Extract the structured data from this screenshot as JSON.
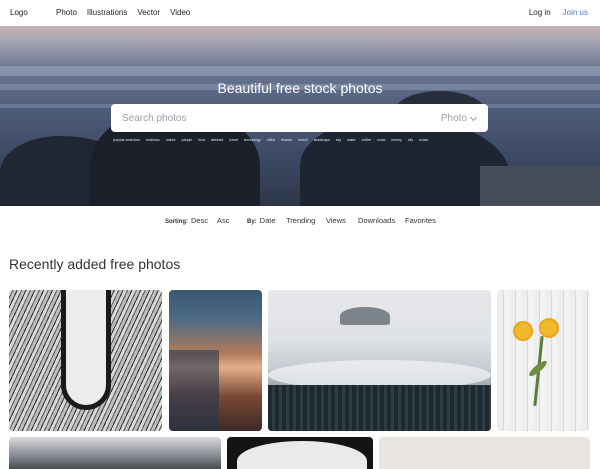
{
  "nav": {
    "logo": "Logo",
    "links": [
      "Photo",
      "Illustrations",
      "Vector",
      "Video"
    ],
    "login": "Log in",
    "join": "Join us"
  },
  "hero": {
    "headline": "Beautiful free stock photos",
    "search_placeholder": "Search photos",
    "search_type": "Photo",
    "tags": [
      "popular searches",
      "business",
      "nature",
      "people",
      "food",
      "abstract",
      "travel",
      "technology",
      "office",
      "flowers",
      "beach",
      "landscape",
      "sky",
      "water",
      "coffee",
      "snow",
      "money",
      "city",
      "music"
    ]
  },
  "sorting": {
    "sorting_label": "Sorting:",
    "desc": "Desc",
    "asc": "Asc",
    "by_label": "By:",
    "date": "Date",
    "trending": "Trending",
    "views": "Views",
    "downloads": "Downloads",
    "favorites": "Favorites"
  },
  "section": {
    "title": "Recently added free photos"
  },
  "colors": {
    "accent": "#4a7bd0"
  }
}
